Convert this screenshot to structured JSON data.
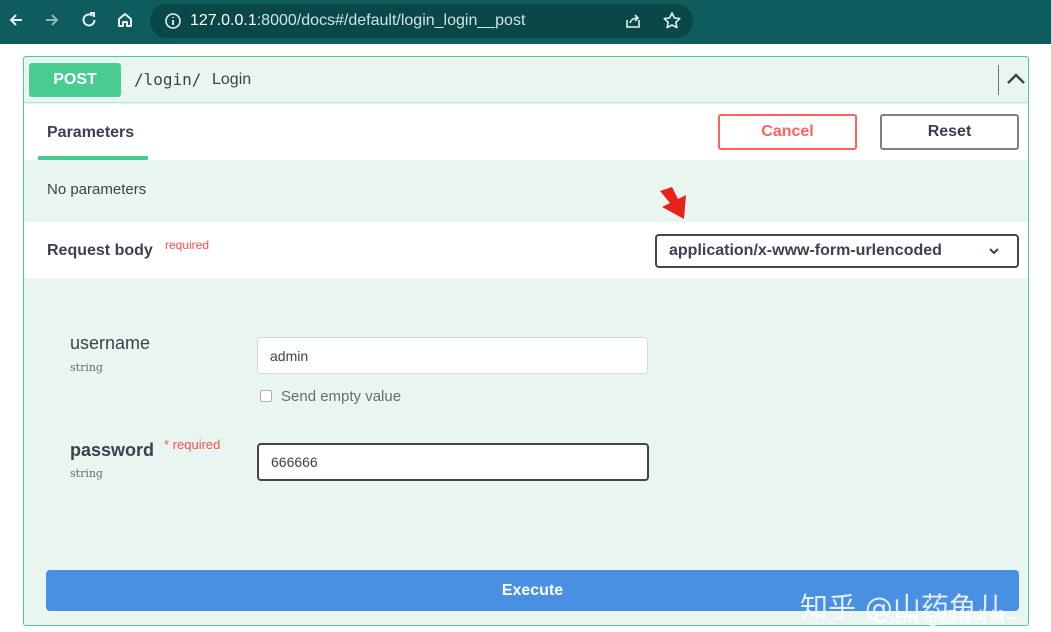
{
  "browser": {
    "url_host": "127.0.0.1",
    "url_rest": ":8000/docs#/default/login_login__post"
  },
  "operation": {
    "method": "POST",
    "path": "/login/",
    "description": "Login"
  },
  "parameters": {
    "tab_label": "Parameters",
    "cancel_label": "Cancel",
    "reset_label": "Reset",
    "empty_text": "No parameters"
  },
  "request_body": {
    "title": "Request body",
    "required_label": "required",
    "content_type": "application/x-www-form-urlencoded"
  },
  "fields": {
    "username": {
      "name": "username",
      "type": "string",
      "value": "admin",
      "send_empty_label": "Send empty value"
    },
    "password": {
      "name": "password",
      "required_label": "* required",
      "type": "string",
      "value": "666666"
    }
  },
  "execute_label": "Execute",
  "watermark": {
    "main": "知乎 @山药鱼儿",
    "sub": "CSDN @顺其自然~"
  },
  "colors": {
    "post_green": "#49cc90",
    "cancel_red": "#ff6060",
    "execute_blue": "#4990e2",
    "chrome_teal": "#0f5c5c"
  }
}
